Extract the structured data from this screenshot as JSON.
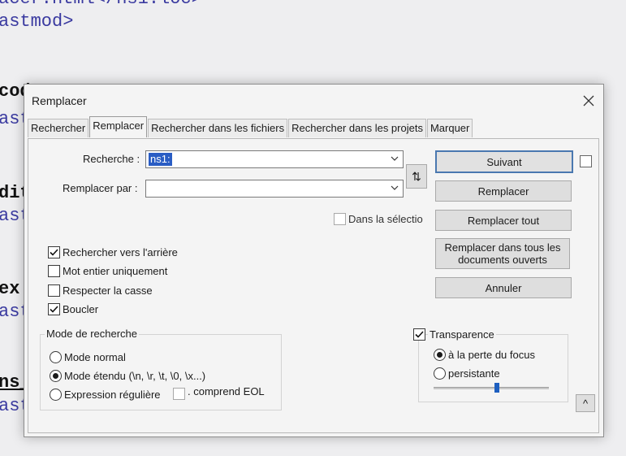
{
  "editor": {
    "lines": [
      {
        "text": "acer.html</ns1:loc>",
        "style": "c-blue"
      },
      {
        "text": "astmod>",
        "style": "c-blue"
      },
      {
        "text": "cod",
        "style": "c-bold"
      },
      {
        "text": "ast",
        "style": "c-blue"
      },
      {
        "text": "dit",
        "style": "c-bold"
      },
      {
        "text": "ast",
        "style": "c-blue"
      },
      {
        "text": "ex",
        "style": "c-bold"
      },
      {
        "text": "ast",
        "style": "c-blue"
      },
      {
        "text": "ns_",
        "style": "c-bold"
      },
      {
        "text": "ast",
        "style": "c-blue"
      }
    ]
  },
  "dialog": {
    "title": "Remplacer",
    "tabs": [
      "Rechercher",
      "Remplacer",
      "Rechercher dans les fichiers",
      "Rechercher dans les projets",
      "Marquer"
    ],
    "active_tab": "Remplacer",
    "search_label": "Recherche :",
    "search_value": "ns1:",
    "replace_label": "Remplacer par :",
    "replace_value": "",
    "in_selection_label": "Dans la sélectio",
    "options": {
      "backward": {
        "label": "Rechercher vers l'arrière",
        "checked": true
      },
      "whole_word": {
        "label": "Mot entier uniquement",
        "checked": false
      },
      "match_case": {
        "label": "Respecter la casse",
        "checked": false
      },
      "wrap": {
        "label": "Boucler",
        "checked": true
      }
    },
    "search_mode": {
      "title": "Mode de recherche",
      "normal": "Mode normal",
      "extended": "Mode étendu (\\n, \\r, \\t, \\0, \\x...)",
      "regex": "Expression régulière",
      "eol": ". comprend EOL",
      "selected": "extended"
    },
    "buttons": {
      "next": "Suivant",
      "replace": "Remplacer",
      "replace_all": "Remplacer tout",
      "replace_all_docs": "Remplacer dans tous les documents ouverts",
      "cancel": "Annuler",
      "swap": "⇅",
      "expand": "^"
    },
    "transparency": {
      "label": "Transparence",
      "checked": true,
      "on_focus_loss": "à la perte du focus",
      "persistent": "persistante",
      "selected": "on_focus_loss",
      "level": 0.55
    }
  }
}
